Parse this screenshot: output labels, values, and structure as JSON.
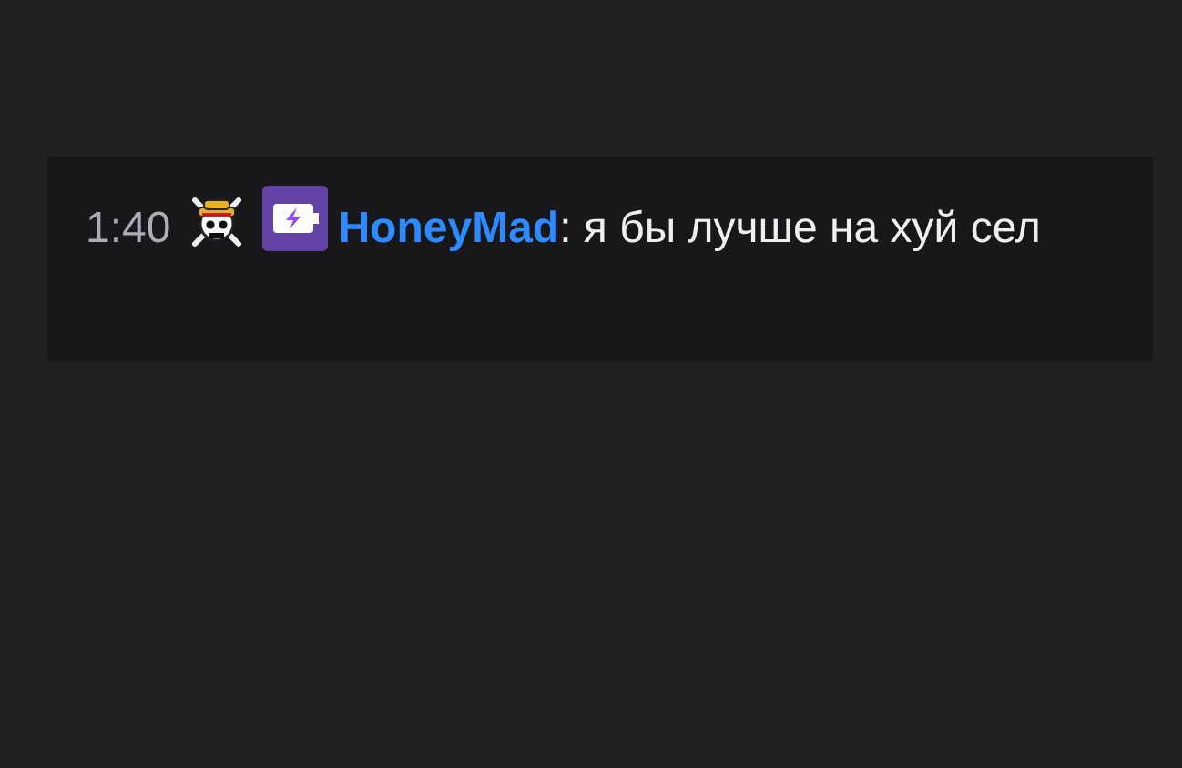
{
  "message": {
    "time": "1:40",
    "badges": [
      {
        "kind": "skull"
      },
      {
        "kind": "battery"
      }
    ],
    "username": "HoneyMad",
    "separator": ":",
    "text": "я бы лучше на хуй сел"
  }
}
